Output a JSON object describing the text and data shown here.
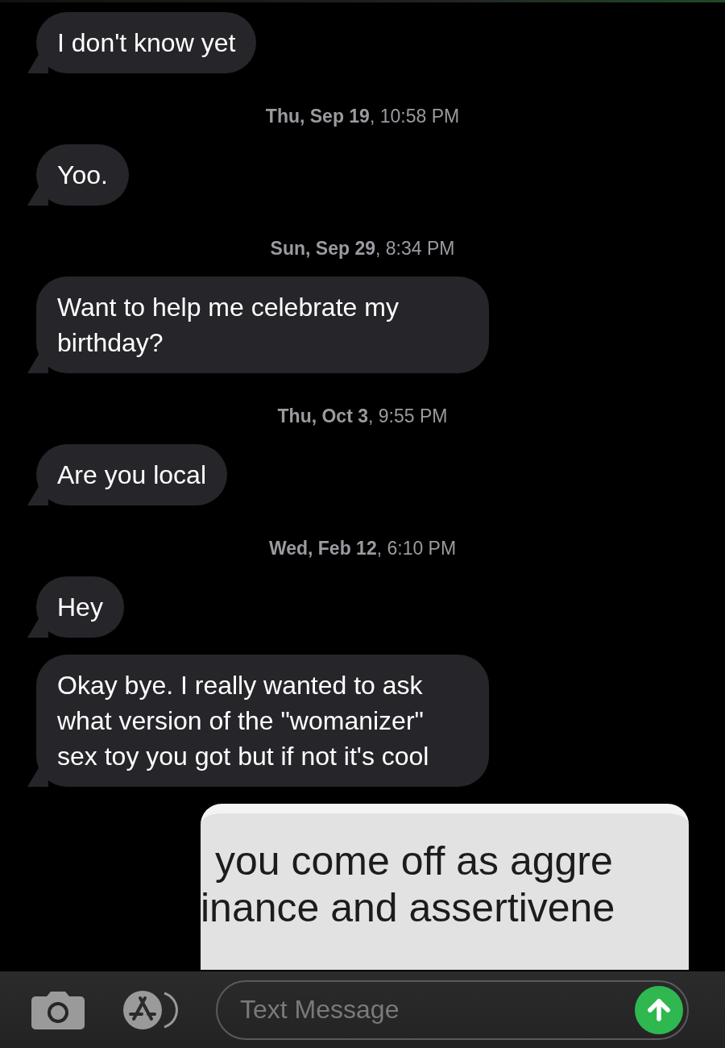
{
  "messages": [
    {
      "kind": "bubble",
      "text": "I don't know yet"
    },
    {
      "kind": "timestamp",
      "text": "**Thu, Sep 19**, 10:58 PM"
    },
    {
      "kind": "bubble",
      "text": "Yoo."
    },
    {
      "kind": "timestamp",
      "text": "**Sun, Sep 29**, 8:34 PM"
    },
    {
      "kind": "bubble",
      "text": "Want to help me celebrate my birthday?"
    },
    {
      "kind": "timestamp",
      "text": "**Thu, Oct 3**, 9:55 PM"
    },
    {
      "kind": "bubble",
      "text": "Are you local"
    },
    {
      "kind": "timestamp",
      "text": "**Wed, Feb 12**, 6:10 PM"
    },
    {
      "kind": "bubble",
      "text": "Hey"
    },
    {
      "kind": "bubble",
      "text": "Okay bye. I really wanted to ask what version of the \"womanizer\" sex toy you got but if not it's cool"
    },
    {
      "kind": "image",
      "lines": [
        "you come off as aggre",
        "inance and assertivene"
      ]
    }
  ],
  "composer": {
    "placeholder": "Text Message"
  }
}
